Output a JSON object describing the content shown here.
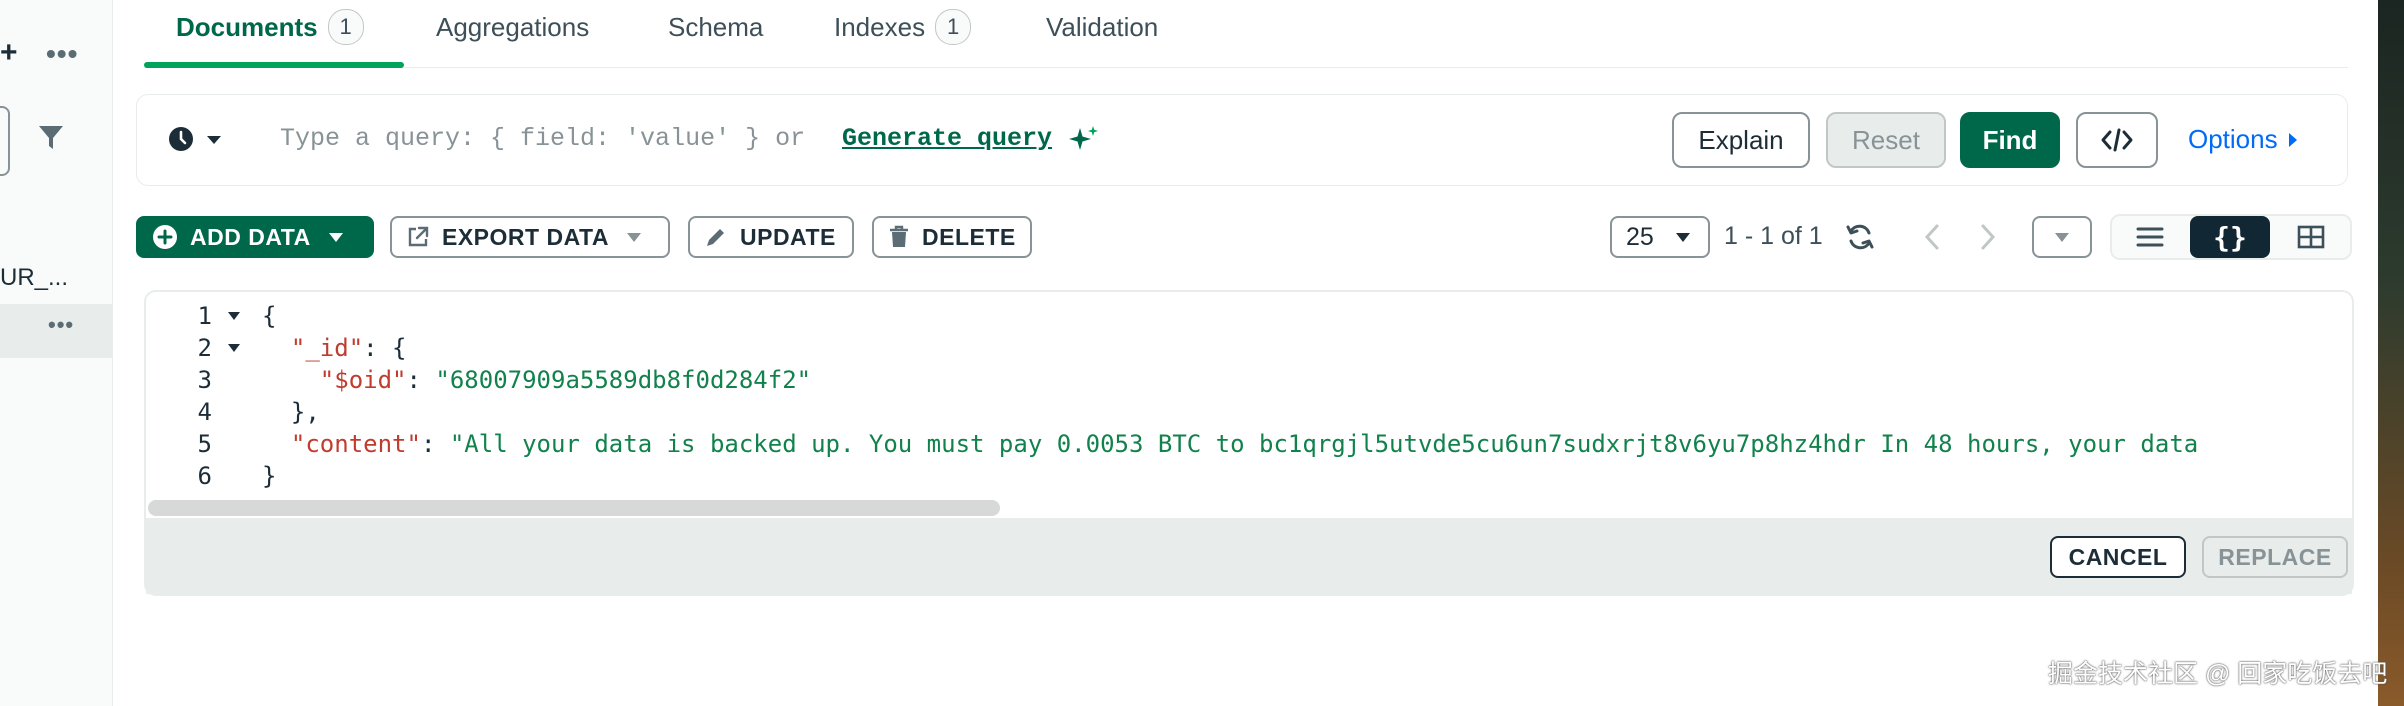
{
  "sidebar": {
    "truncated_label": "UR_...",
    "more_label": "•••",
    "add_glyph": "+"
  },
  "tabs": [
    {
      "label": "Documents",
      "badge": "1",
      "active": true
    },
    {
      "label": "Aggregations"
    },
    {
      "label": "Schema"
    },
    {
      "label": "Indexes",
      "badge": "1"
    },
    {
      "label": "Validation"
    }
  ],
  "query": {
    "placeholder": "Type a query: { field: 'value' } or",
    "generate_link": "Generate query",
    "buttons": {
      "explain": "Explain",
      "reset": "Reset",
      "find": "Find",
      "options": "Options"
    }
  },
  "actions": {
    "add_data": "ADD DATA",
    "export_data": "EXPORT DATA",
    "update": "UPDATE",
    "delete": "DELETE"
  },
  "pagination": {
    "page_size": "25",
    "range": "1 - 1 of 1"
  },
  "editor": {
    "line_numbers": [
      "1",
      "2",
      "3",
      "4",
      "5",
      "6"
    ],
    "lines": [
      {
        "parts": [
          {
            "t": "{",
            "c": "p"
          }
        ]
      },
      {
        "parts": [
          {
            "t": "  ",
            "c": "p"
          },
          {
            "t": "\"_id\"",
            "c": "k"
          },
          {
            "t": ": {",
            "c": "p"
          }
        ]
      },
      {
        "parts": [
          {
            "t": "    ",
            "c": "p"
          },
          {
            "t": "\"$oid\"",
            "c": "k"
          },
          {
            "t": ": ",
            "c": "p"
          },
          {
            "t": "\"68007909a5589db8f0d284f2\"",
            "c": "s"
          }
        ]
      },
      {
        "parts": [
          {
            "t": "  },",
            "c": "p"
          }
        ]
      },
      {
        "parts": [
          {
            "t": "  ",
            "c": "p"
          },
          {
            "t": "\"content\"",
            "c": "k"
          },
          {
            "t": ": ",
            "c": "p"
          },
          {
            "t": "\"All your data is backed up. You must pay 0.0053 BTC to bc1qrgjl5utvde5cu6un7sudxrjt8v6yu7p8hz4hdr In 48 hours, your data",
            "c": "s"
          }
        ]
      },
      {
        "parts": [
          {
            "t": "}",
            "c": "p"
          }
        ]
      }
    ],
    "cancel": "CANCEL",
    "replace": "REPLACE"
  },
  "watermark": "掘金技术社区 @ 回家吃饭去吧",
  "colors": {
    "brand_green": "#00684a",
    "accent_green": "#00a35c",
    "link_blue": "#016bf8",
    "key_red": "#c23c2e",
    "string_green": "#12824d"
  }
}
